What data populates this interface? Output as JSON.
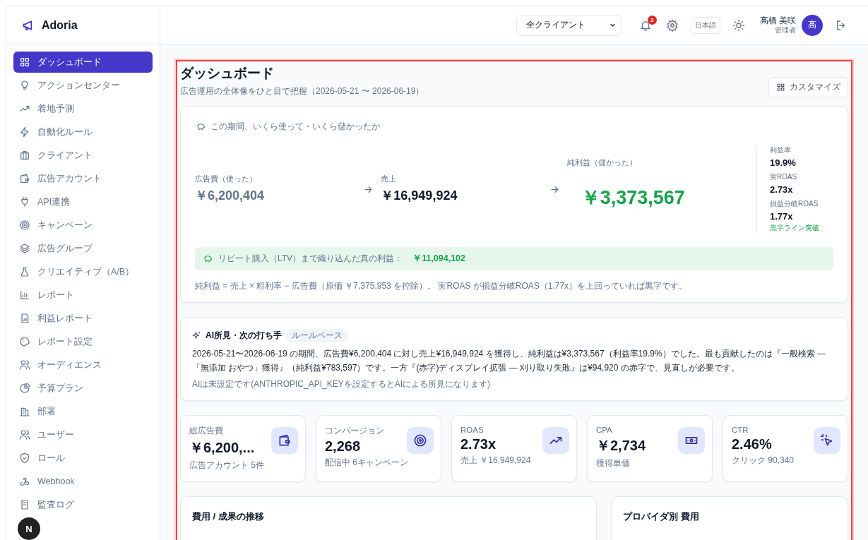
{
  "brand": "Adoria",
  "sidebar": {
    "items": [
      {
        "label": "ダッシュボード",
        "selected": true
      },
      {
        "label": "アクションセンター",
        "selected": false
      },
      {
        "label": "着地予測",
        "selected": false
      },
      {
        "label": "自動化ルール",
        "selected": false
      },
      {
        "label": "クライアント",
        "selected": false
      },
      {
        "label": "広告アカウント",
        "selected": false
      },
      {
        "label": "API連携",
        "selected": false
      },
      {
        "label": "キャンペーン",
        "selected": false
      },
      {
        "label": "広告グループ",
        "selected": false
      },
      {
        "label": "クリエイティブ（A/B）",
        "selected": false
      },
      {
        "label": "レポート",
        "selected": false
      },
      {
        "label": "利益レポート",
        "selected": false
      },
      {
        "label": "レポート設定",
        "selected": false
      },
      {
        "label": "オーディエンス",
        "selected": false
      },
      {
        "label": "予算プラン",
        "selected": false
      },
      {
        "label": "部署",
        "selected": false
      },
      {
        "label": "ユーザー",
        "selected": false
      },
      {
        "label": "ロール",
        "selected": false
      },
      {
        "label": "Webhook",
        "selected": false
      },
      {
        "label": "監査ログ",
        "selected": false
      }
    ]
  },
  "header": {
    "client_select": {
      "value": "全クライアント"
    },
    "notification_count": "2",
    "language": "日本語",
    "user": {
      "name": "高橋 美咲",
      "role": "管理者",
      "avatar": "高"
    }
  },
  "dev_badge": "N",
  "dashboard": {
    "title": "ダッシュボード",
    "subtitle": "広告運用の全体像をひと目で把握（2026-05-21 〜 2026-06-19）",
    "customize_button": "カスタマイズ"
  },
  "profit_card": {
    "heading": "この期間、いくら使って・いくら儲かったか",
    "flow": [
      {
        "kind": "spend",
        "label": "広告費（使った）",
        "value": "￥6,200,404"
      },
      {
        "kind": "sales",
        "label": "売上",
        "value": "￥16,949,924"
      },
      {
        "kind": "profit",
        "label": "純利益（儲かった）",
        "value": "￥3,373,567"
      }
    ],
    "side_metrics": [
      {
        "label": "利益率",
        "value": "19.9%"
      },
      {
        "label": "実ROAS",
        "value": "2.73x"
      },
      {
        "label": "損益分岐ROAS",
        "value": "1.77x"
      }
    ],
    "side_note": "黒字ライン突破",
    "ltv": {
      "label": "リピート購入（LTV）まで織り込んだ真の利益：",
      "value": "￥11,094,102"
    },
    "footnote": "純利益 = 売上 × 粗利率 − 広告費（原価 ￥7,375,953 を控除）。 実ROAS が損益分岐ROAS（1.77x）を上回っていれば黒字です。"
  },
  "ai_card": {
    "title": "AI所見・次の打ち手",
    "tag": "ルールベース",
    "body": "2026-05-21〜2026-06-19 の期間、広告費¥6,200,404 に対し売上¥16,949,924 を獲得し、純利益は¥3,373,567（利益率19.9%）でした。最も貢献したのは『一般検索 —「無添加 おやつ」獲得』（純利益¥783,597）です。一方『(赤字)ディスプレイ拡張 — 刈り取り失敗』は¥94,920 の赤字で、見直しが必要です。",
    "note": "AIは未設定です(ANTHROPIC_API_KEYを設定するとAIによる所見になります)"
  },
  "kpis": [
    {
      "label": "総広告費",
      "value": "￥6,200,...",
      "sub": "広告アカウント 5件"
    },
    {
      "label": "コンバージョン",
      "value": "2,268",
      "sub": "配信中 6キャンペーン"
    },
    {
      "label": "ROAS",
      "value": "2.73x",
      "sub": "売上 ￥16,949,924"
    },
    {
      "label": "CPA",
      "value": "￥2,734",
      "sub": "獲得単価"
    },
    {
      "label": "CTR",
      "value": "2.46%",
      "sub": "クリック 90,340"
    }
  ],
  "panels": [
    {
      "title": "費用 / 成果の推移"
    },
    {
      "title": "プロバイダ別 費用"
    }
  ]
}
